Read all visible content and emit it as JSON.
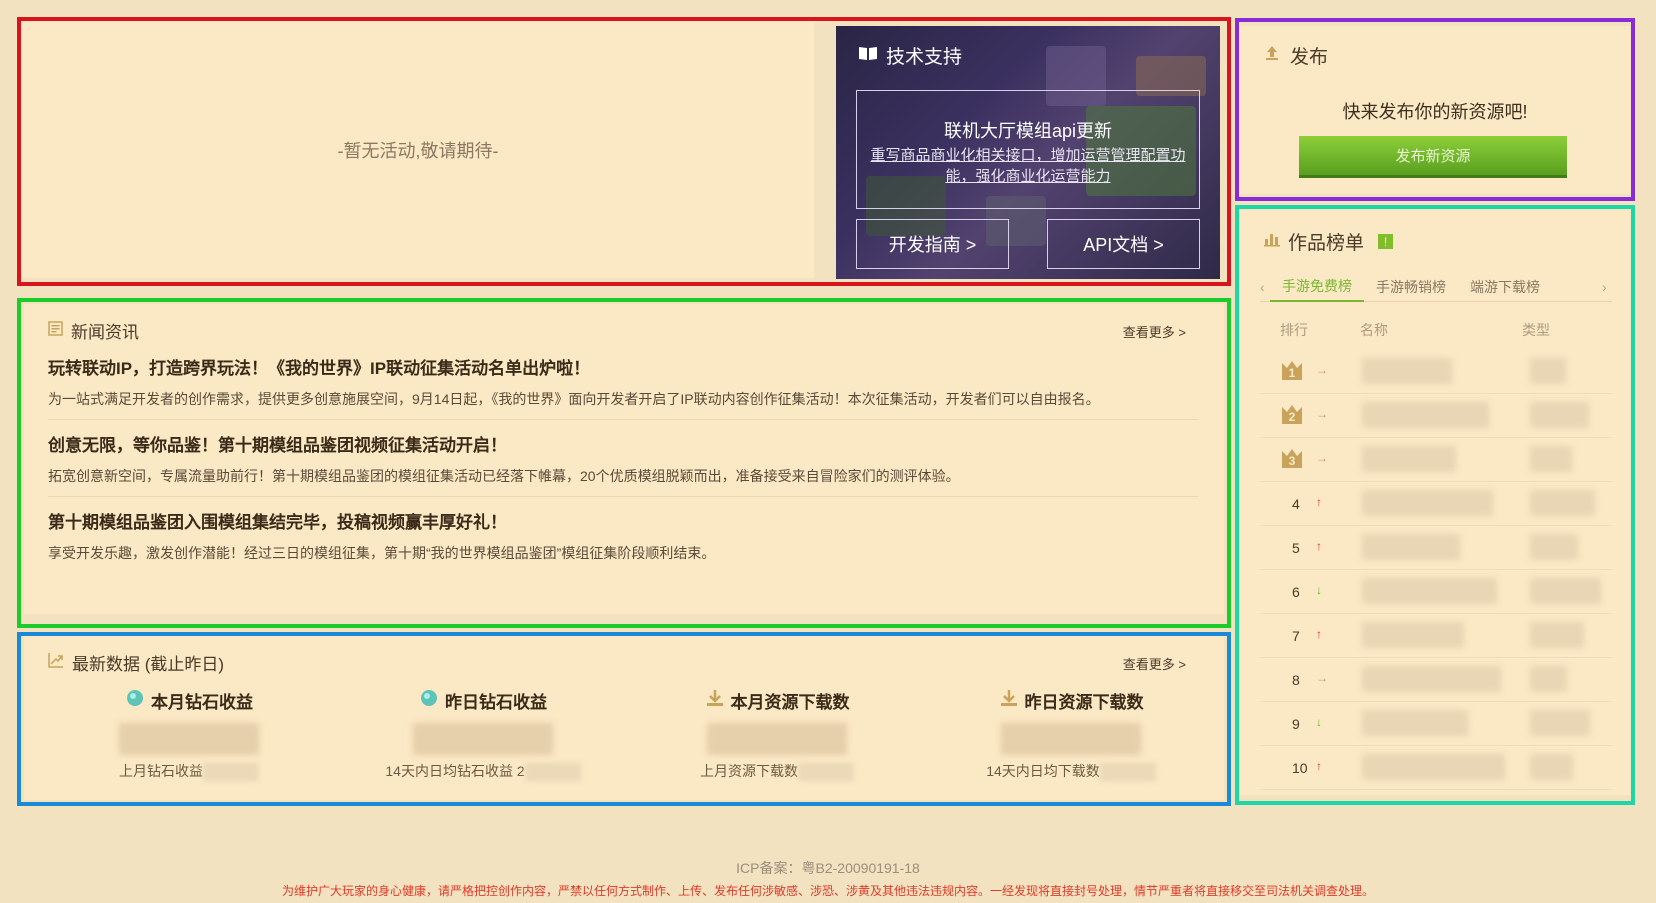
{
  "activity": {
    "empty_text": "-暂无活动,敬请期待-"
  },
  "tech": {
    "title": "技术支持",
    "news_title": "联机大厅模组api更新",
    "news_desc": "重写商品商业化相关接口，增加运营管理配置功能，强化商业化运营能力",
    "guide_label": "开发指南 >",
    "api_label": "API文档 >"
  },
  "publish": {
    "title": "发布",
    "slogan": "快来发布你的新资源吧!",
    "button": "发布新资源"
  },
  "ranking": {
    "title": "作品榜单",
    "badge": "!",
    "tabs": [
      "手游免费榜",
      "手游畅销榜",
      "端游下载榜"
    ],
    "columns": {
      "rank": "排行",
      "name": "名称",
      "type": "类型"
    },
    "rows": [
      {
        "rank": "1",
        "trend": "→"
      },
      {
        "rank": "2",
        "trend": "→"
      },
      {
        "rank": "3",
        "trend": "→"
      },
      {
        "rank": "4",
        "trend": "↑"
      },
      {
        "rank": "5",
        "trend": "↑"
      },
      {
        "rank": "6",
        "trend": "↓"
      },
      {
        "rank": "7",
        "trend": "↑"
      },
      {
        "rank": "8",
        "trend": "→"
      },
      {
        "rank": "9",
        "trend": "↓"
      },
      {
        "rank": "10",
        "trend": "↑"
      }
    ],
    "colors": {
      "up": "#e03a2a",
      "down": "#6ab52a",
      "flat": "#d08a6a"
    }
  },
  "news": {
    "title": "新闻资讯",
    "more": "查看更多 >",
    "items": [
      {
        "title": "玩转联动IP，打造跨界玩法！《我的世界》IP联动征集活动名单出炉啦！",
        "desc": "为一站式满足开发者的创作需求，提供更多创意施展空间，9月14日起，《我的世界》面向开发者开启了IP联动内容创作征集活动！本次征集活动，开发者们可以自由报名。"
      },
      {
        "title": "创意无限，等你品鉴！第十期模组品鉴团视频征集活动开启！",
        "desc": "拓宽创意新空间，专属流量助前行！第十期模组品鉴团的模组征集活动已经落下帷幕，20个优质模组脱颖而出，准备接受来自冒险家们的测评体验。"
      },
      {
        "title": "第十期模组品鉴团入围模组集结完毕，投稿视频赢丰厚好礼！",
        "desc": "享受开发乐趣，激发创作潜能！经过三日的模组征集，第十期“我的世界模组品鉴团”模组征集阶段顺利结束。"
      }
    ]
  },
  "data_section": {
    "title": "最新数据 (截止昨日)",
    "more": "查看更多 >",
    "stats": [
      {
        "label": "本月钻石收益",
        "sub": "上月钻石收益",
        "icon": "diamond-icon"
      },
      {
        "label": "昨日钻石收益",
        "sub": "14天内日均钻石收益 2",
        "icon": "diamond-icon"
      },
      {
        "label": "本月资源下载数",
        "sub": "上月资源下载数",
        "icon": "download-icon"
      },
      {
        "label": "昨日资源下载数",
        "sub": "14天内日均下载数",
        "icon": "download-icon"
      }
    ]
  },
  "footer": {
    "icp": "ICP备案：粤B2-20090191-18",
    "warning": "为维护广大玩家的身心健康，请严格把控创作内容，严禁以任何方式制作、上传、发布任何涉敏感、涉恐、涉黄及其他违法违规内容。一经发现将直接封号处理，情节严重者将直接移交至司法机关调查处理。"
  },
  "frame_colors": {
    "activity": "#d8141c",
    "publish": "#8a2bd8",
    "ranking": "#1ed6a6",
    "news": "#1ccc2a",
    "data": "#1a8ad8"
  }
}
